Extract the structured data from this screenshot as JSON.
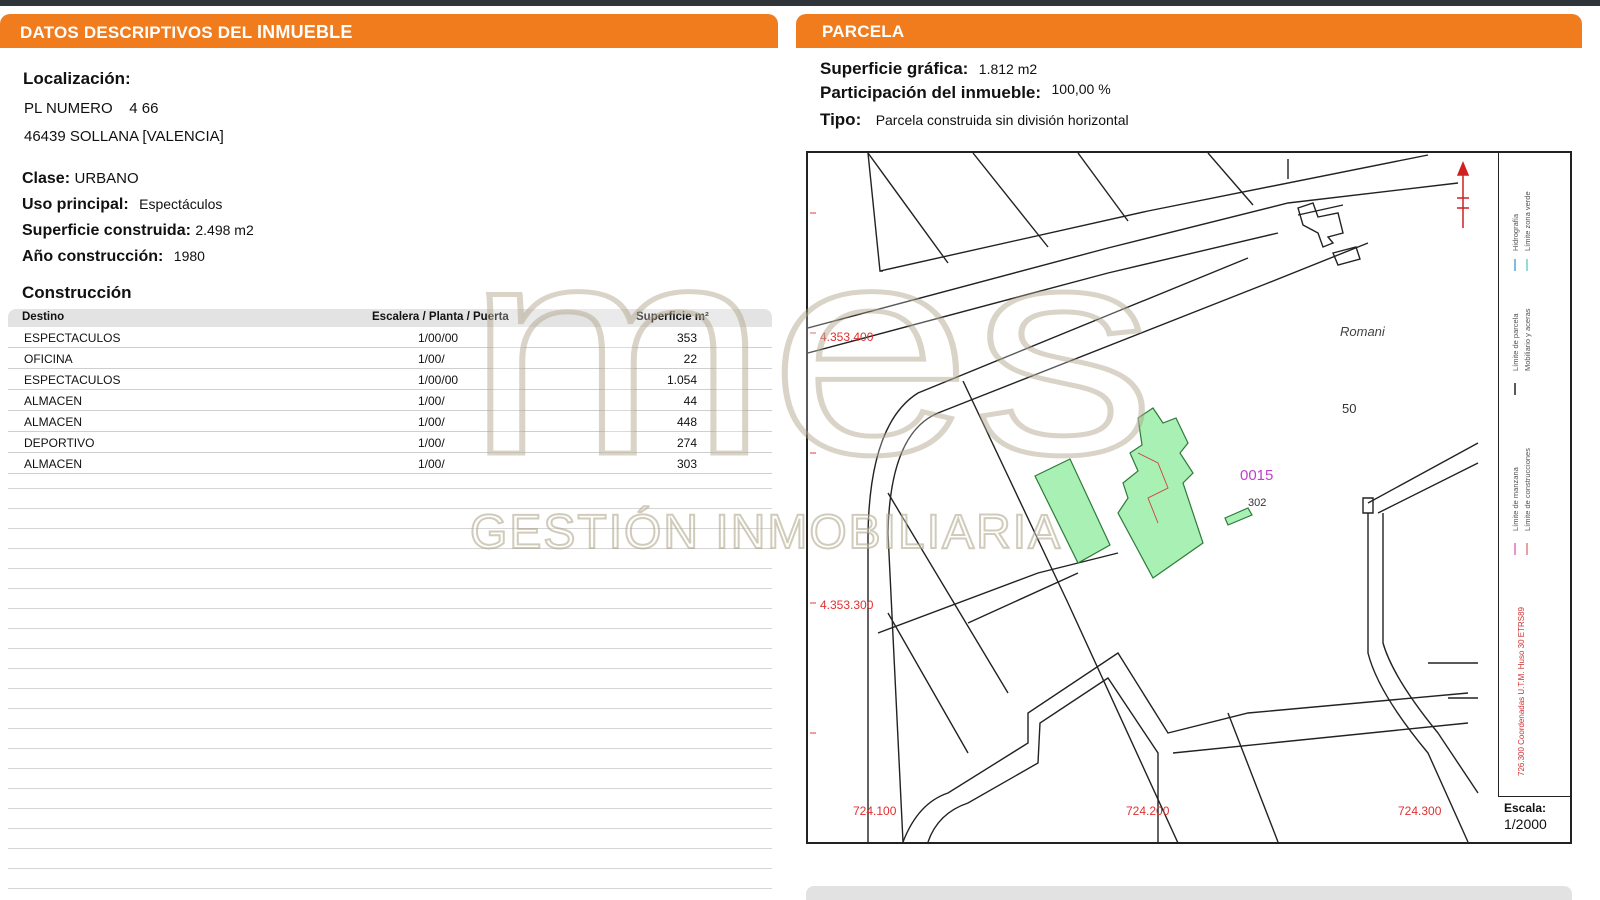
{
  "left_section": {
    "title_prefix": "DATOS DESCRIPTIVOS DEL ",
    "title_bold": "INMUEBLE",
    "localizacion_label": "Localización:",
    "address_line1": "PL NUMERO    4 66",
    "address_line2": "46439 SOLLANA [VALENCIA]",
    "clase_label": "Clase:",
    "clase_value": "URBANO",
    "uso_label": "Uso principal:",
    "uso_value": "Espectáculos",
    "superficie_label": "Superficie construida:",
    "superficie_value": "2.498 m2",
    "anio_label": "Año construcción:",
    "anio_value": "1980",
    "construccion_label": "Construcción",
    "table": {
      "headers": [
        "Destino",
        "Escalera / Planta / Puerta",
        "Superficie m²"
      ],
      "rows": [
        [
          "ESPECTACULOS",
          "1/00/00",
          "353"
        ],
        [
          "OFICINA",
          "1/00/",
          "22"
        ],
        [
          "ESPECTACULOS",
          "1/00/00",
          "1.054"
        ],
        [
          "ALMACEN",
          "1/00/",
          "44"
        ],
        [
          "ALMACEN",
          "1/00/",
          "448"
        ],
        [
          "DEPORTIVO",
          "1/00/",
          "274"
        ],
        [
          "ALMACEN",
          "1/00/",
          "303"
        ]
      ]
    }
  },
  "right_section": {
    "title": "PARCELA",
    "superficie_grafica_label": "Superficie gráfica:",
    "superficie_grafica_value": "1.812 m2",
    "participacion_label": "Participación del inmueble:",
    "participacion_value": "100,00 %",
    "tipo_label": "Tipo:",
    "tipo_value": "Parcela construida sin división horizontal"
  },
  "map": {
    "coord_y1": "4.353.400",
    "coord_y2": "4.353.300",
    "coord_x1": "724.100",
    "coord_x2": "724.200",
    "coord_x3": "724.300",
    "place_label": "Romani",
    "number_50": "50",
    "parcel_code": "0015",
    "number_302": "302",
    "escala_label": "Escala:",
    "escala_value": "1/2000",
    "legend_1": "Límite de parcela",
    "legend_2": "Mobiliario y aceras",
    "legend_3": "Límite de manzana",
    "legend_4": "Límite de construcciones",
    "legend_5": "Hidrografía",
    "legend_6": "Límite zona verde",
    "utm_note": "726.300 Coordenadas U.T.M. Huso 30 ETRS89",
    "colors": {
      "parcel_fill": "#a8f0b4",
      "coord_red": "#e03030",
      "code_magenta": "#c040d0"
    }
  },
  "watermark": {
    "logo_text": "mes",
    "subtitle": "GESTIÓN INMOBILIARIA"
  },
  "colors": {
    "header_orange": "#f07c1e",
    "top_bar": "#2f3438"
  }
}
